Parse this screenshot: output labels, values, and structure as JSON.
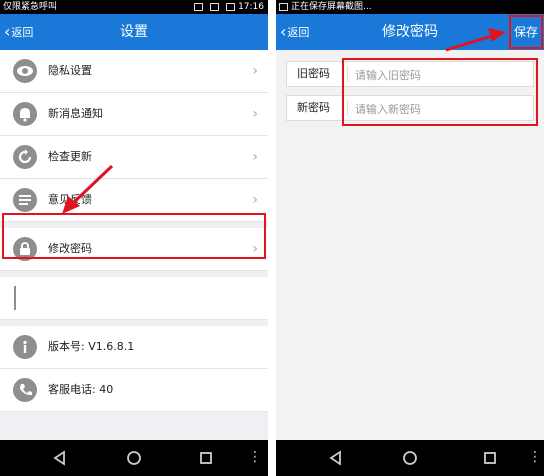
{
  "left": {
    "status": {
      "left_text": "仅限紧急呼叫",
      "time": "17:16"
    },
    "appbar": {
      "back": "返回",
      "title": "设置"
    },
    "items": [
      {
        "label": "隐私设置",
        "icon": "eye-icon"
      },
      {
        "label": "新消息通知",
        "icon": "bell-icon"
      },
      {
        "label": "检查更新",
        "icon": "refresh-icon"
      },
      {
        "label": "意见反馈",
        "icon": "chat-icon"
      },
      {
        "label": "修改密码",
        "icon": "lock-icon"
      },
      {
        "label": "",
        "icon": "blank-icon"
      },
      {
        "label": "版本号: V1.6.8.1",
        "icon": "info-icon"
      },
      {
        "label": "客服电话: 40",
        "icon": "phone-icon"
      }
    ],
    "chevron": "›"
  },
  "right": {
    "status": {
      "left_text": "正在保存屏幕截图..."
    },
    "appbar": {
      "back": "返回",
      "title": "修改密码",
      "save": "保存"
    },
    "fields": [
      {
        "label": "旧密码",
        "placeholder": "请输入旧密码"
      },
      {
        "label": "新密码",
        "placeholder": "请输入新密码"
      }
    ]
  },
  "colors": {
    "accent": "#1a78d9",
    "highlight": "#e0141e"
  }
}
